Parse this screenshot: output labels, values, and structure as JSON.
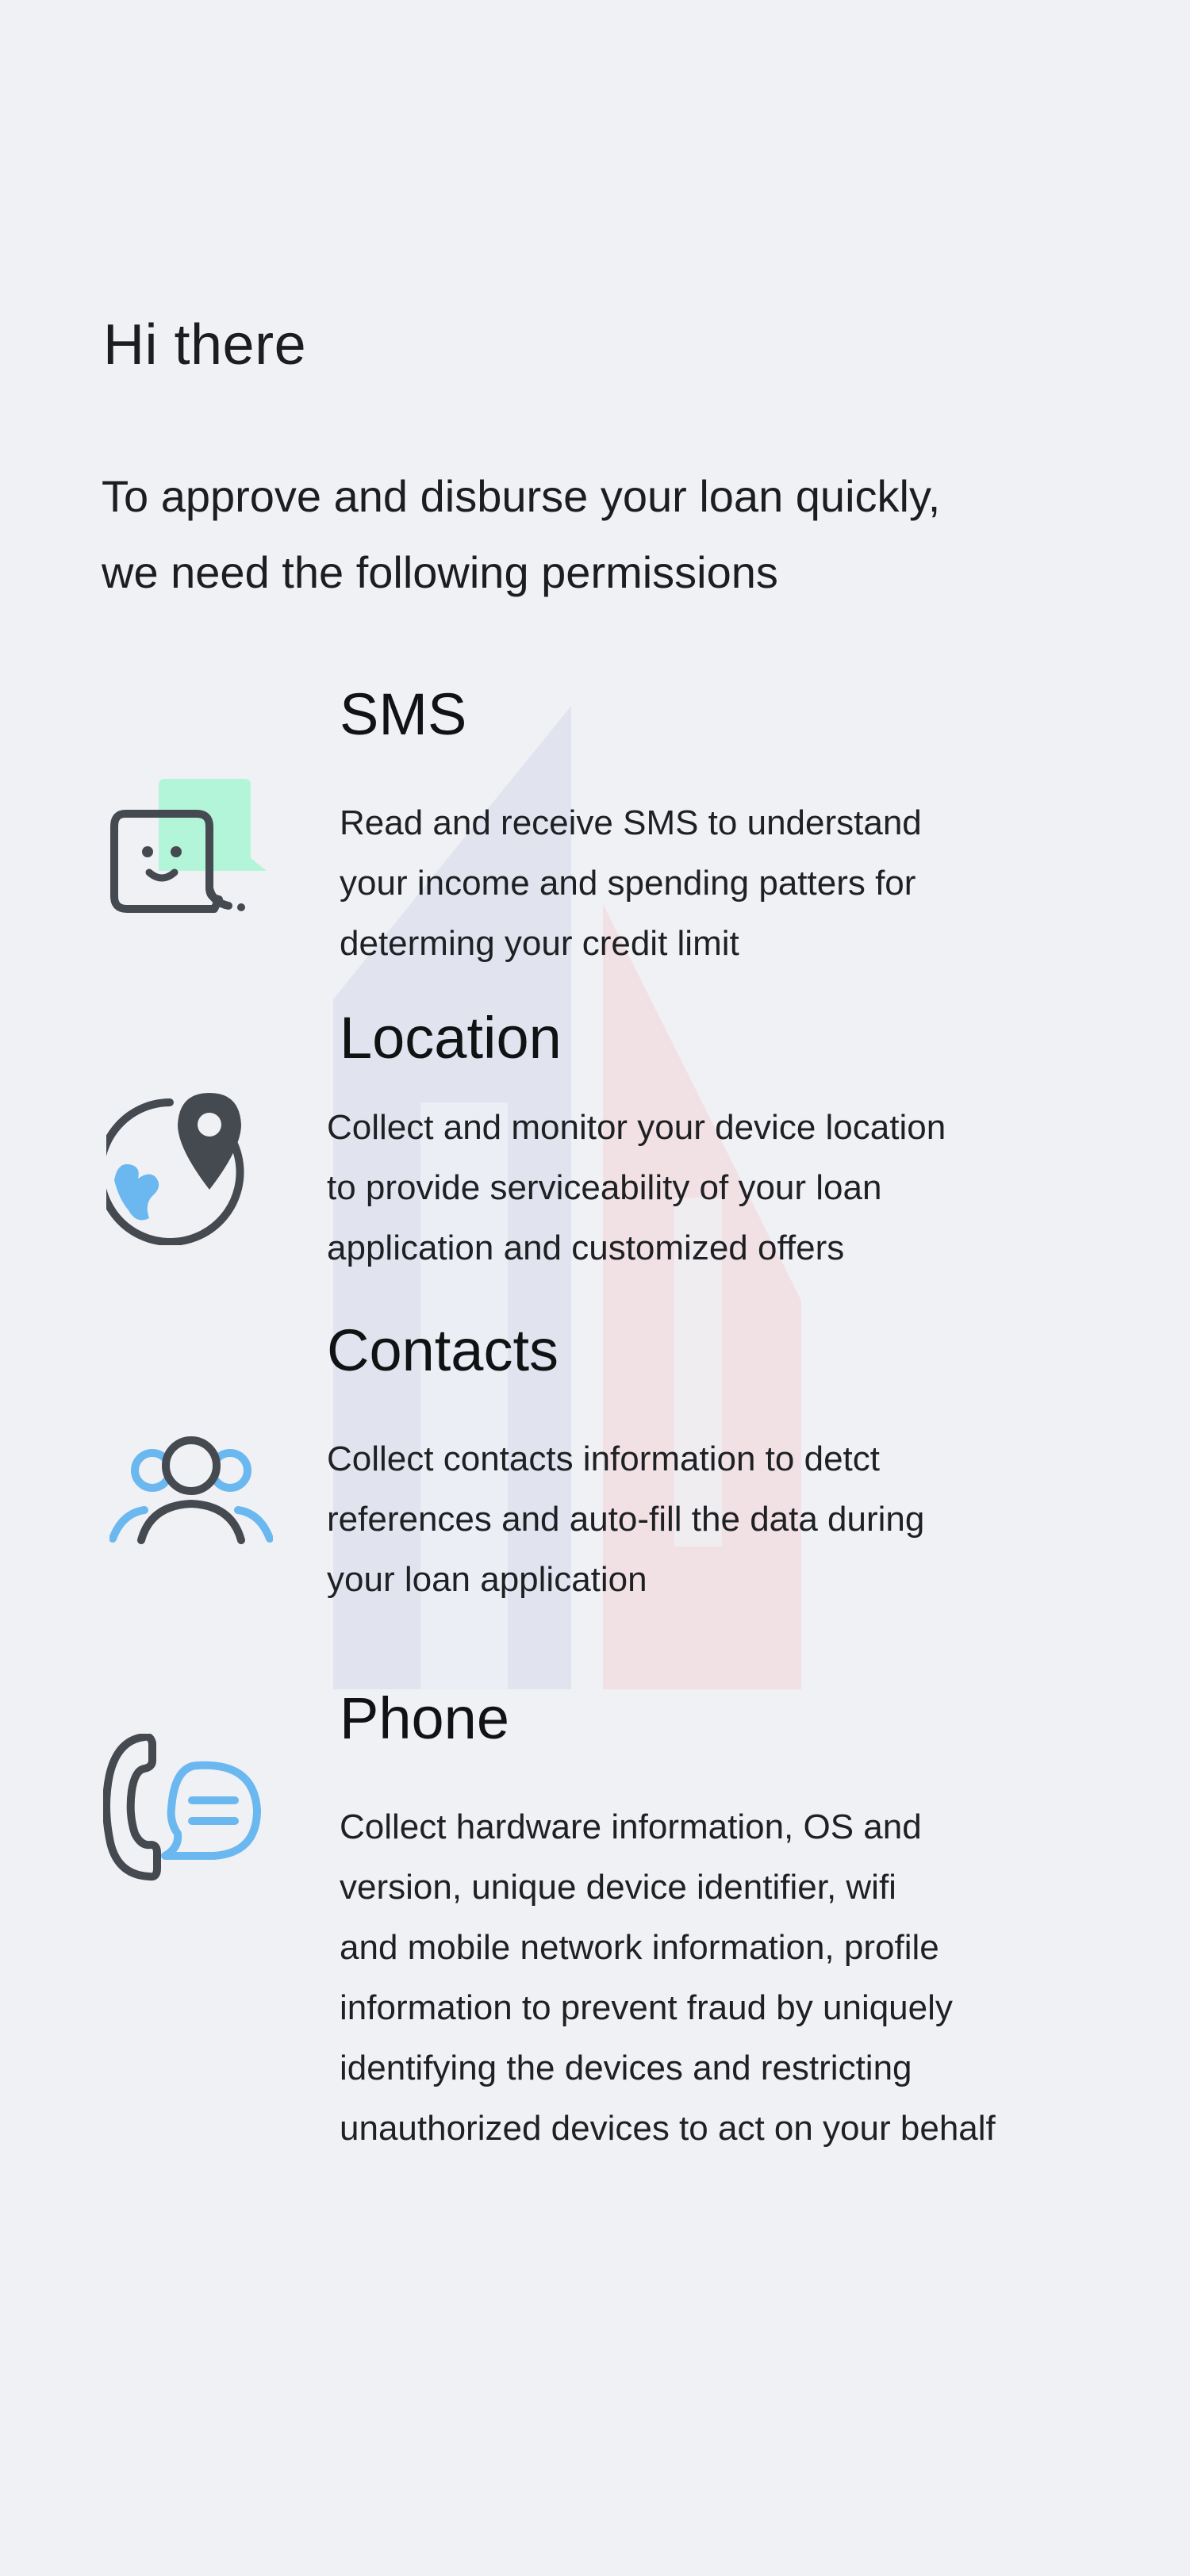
{
  "greeting": "Hi there",
  "intro": "To approve and disburse your loan quickly,\nwe need the following permissions",
  "colors": {
    "background": "#f0f1f5",
    "icon_dark": "#454a50",
    "icon_blue": "#6bb8f0",
    "icon_green": "#b3f5d8",
    "watermark_blue": "#dcdfec",
    "watermark_red": "#f2d9de"
  },
  "permissions": [
    {
      "title": "SMS",
      "icon": "sms-chat-icon",
      "description": "Read and receive SMS to understand\nyour income and spending patters for\ndeterming your credit limit"
    },
    {
      "title": "Location",
      "icon": "location-globe-icon",
      "description": "Collect and monitor your device location\nto provide serviceability of your loan\napplication and customized offers"
    },
    {
      "title": "Contacts",
      "icon": "contacts-people-icon",
      "description": "Collect contacts information to detct\nreferences and auto-fill the data during\nyour loan application"
    },
    {
      "title": "Phone",
      "icon": "phone-message-icon",
      "description": "Collect hardware information, OS and\nversion, unique device identifier, wifi\nand mobile network information, profile\ninformation to prevent fraud by uniquely\nidentifying the devices and restricting\nunauthorized devices to act on your behalf"
    }
  ]
}
